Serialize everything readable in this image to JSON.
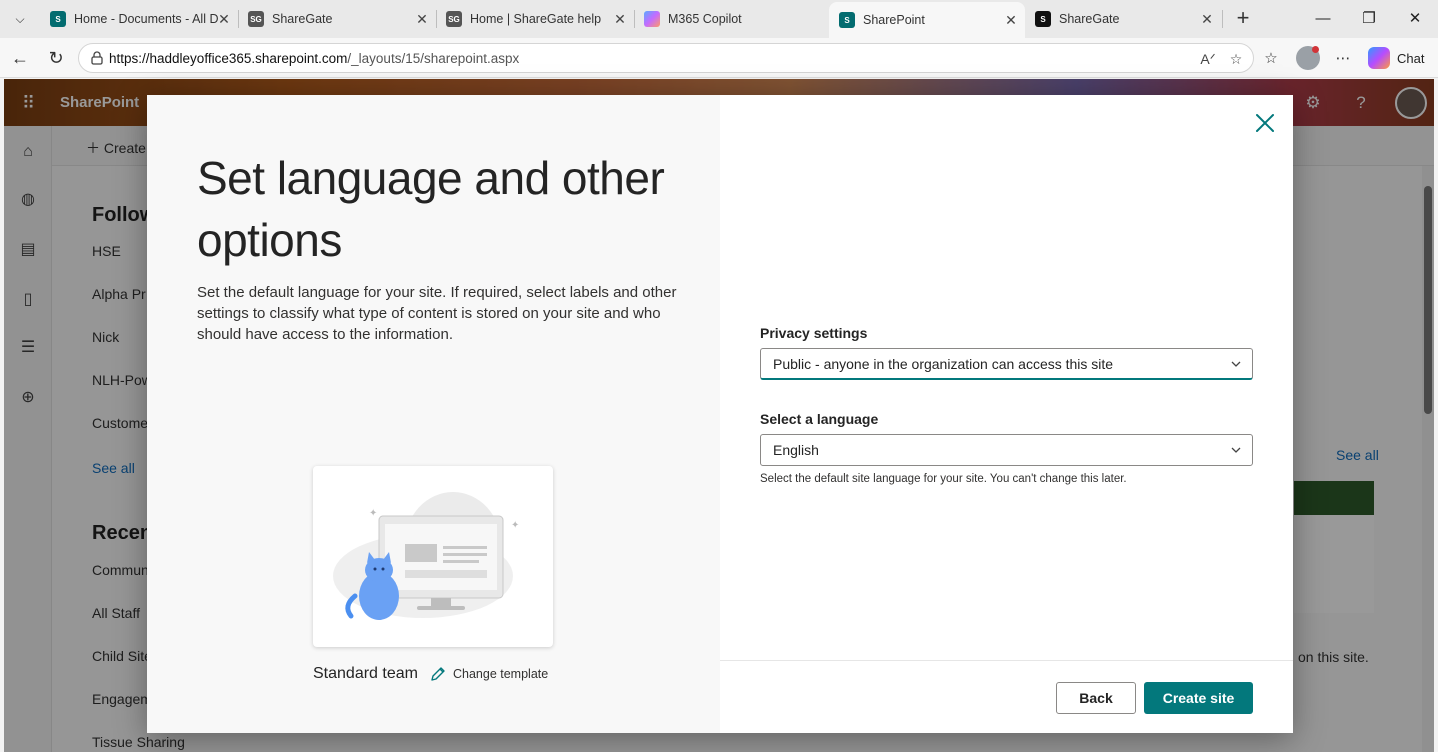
{
  "browser": {
    "tabs": [
      {
        "title": "Home - Documents - All D",
        "icon": "sharepoint-icon",
        "color": "#036c70"
      },
      {
        "title": "ShareGate",
        "icon": "sharegate-icon",
        "color": "#555555"
      },
      {
        "title": "Home | ShareGate help",
        "icon": "sharegate-icon",
        "color": "#555555"
      },
      {
        "title": "M365 Copilot",
        "icon": "copilot-icon",
        "color": "#8a63d2"
      },
      {
        "title": "SharePoint",
        "icon": "sharepoint-icon",
        "color": "#036c70",
        "active": true
      },
      {
        "title": "ShareGate",
        "icon": "sharegate-icon",
        "color": "#111111"
      }
    ],
    "url_domain": "https://haddleyoffice365.sharepoint.com",
    "url_path": "/_layouts/15/sharepoint.aspx",
    "chat_label": "Chat"
  },
  "sharepoint": {
    "brand": "SharePoint",
    "create_label": "Create",
    "following_title": "Follow",
    "following_items": [
      "HSE",
      "Alpha Pr",
      "Nick",
      "NLH-Pow",
      "Custome"
    ],
    "see_all": "See all",
    "recent_title": "Recen",
    "recent_items": [
      "Commun",
      "All Staff",
      "Child Site",
      "Engagem",
      "Tissue Sharing"
    ],
    "right_see_all": "See all",
    "right_text": "on this site."
  },
  "dialog": {
    "title": "Set language and other options",
    "description": "Set the default language for your site. If required, select labels and other settings to classify what type of content is stored on your site and who should have access to the information.",
    "template_name": "Standard team",
    "change_template": "Change template",
    "privacy_label": "Privacy settings",
    "privacy_value": "Public - anyone in the organization can access this site",
    "language_label": "Select a language",
    "language_value": "English",
    "language_help": "Select the default site language for your site. You can't change this later.",
    "back_label": "Back",
    "create_label": "Create site",
    "accent_color": "#03787c"
  }
}
